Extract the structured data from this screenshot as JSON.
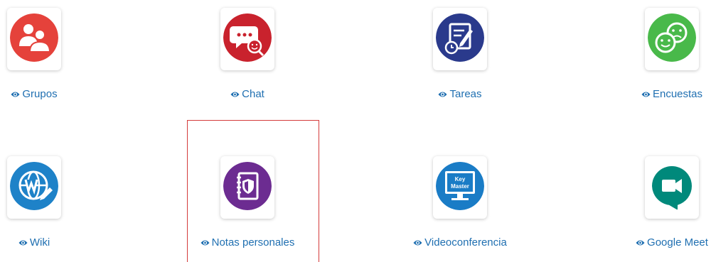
{
  "tools": [
    {
      "label": "Grupos",
      "icon": "groups-icon",
      "color": "#e5423b"
    },
    {
      "label": "Chat",
      "icon": "chat-icon",
      "color": "#c9222d"
    },
    {
      "label": "Tareas",
      "icon": "tasks-icon",
      "color": "#2a3a8c"
    },
    {
      "label": "Encuestas",
      "icon": "surveys-icon",
      "color": "#49b94a"
    },
    {
      "label": "Wiki",
      "icon": "wiki-icon",
      "color": "#1e82c8"
    },
    {
      "label": "Notas personales",
      "icon": "personal-notes-icon",
      "color": "#6c2c91"
    },
    {
      "label": "Videoconferencia",
      "icon": "videoconference-icon",
      "color": "#1a7cc6"
    },
    {
      "label": "Google Meet",
      "icon": "google-meet-icon",
      "color": "#00897b"
    }
  ],
  "eye_icon": "eye-icon",
  "link_color": "#1f6fb1",
  "selected_tool": "Notas personales",
  "keymaster_screen_text": [
    "Key",
    "Master"
  ]
}
